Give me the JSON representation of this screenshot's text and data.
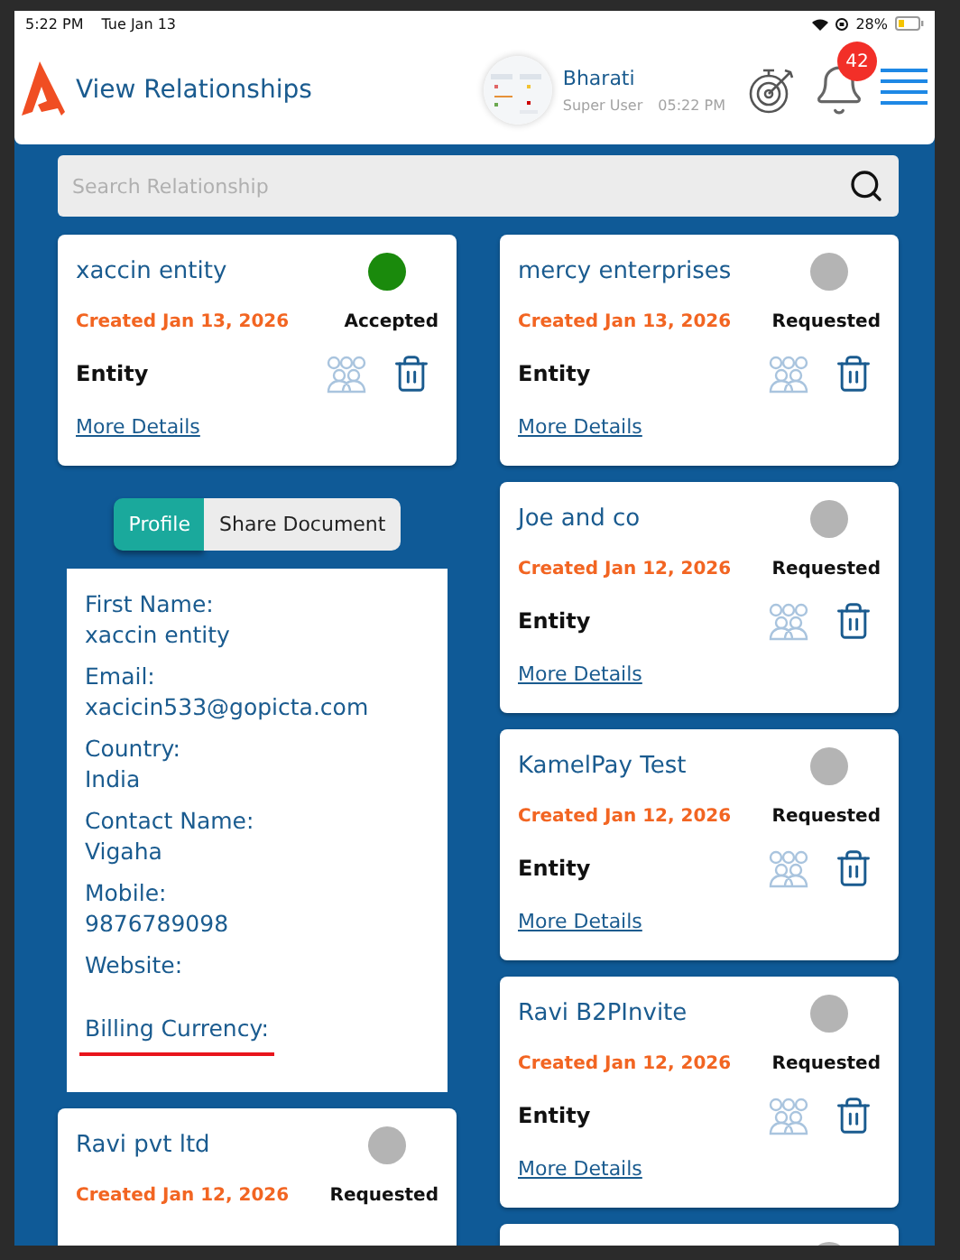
{
  "status_bar": {
    "time": "5:22 PM",
    "date": "Tue Jan 13",
    "battery": "28%"
  },
  "header": {
    "title": "View Relationships",
    "user_name": "Bharati",
    "role": "Super User",
    "time": "05:22 PM",
    "notification_count": "42"
  },
  "search": {
    "placeholder": "Search Relationship"
  },
  "left_cards": [
    {
      "name": "xaccin entity",
      "created": "Created Jan 13, 2026",
      "status": "Accepted",
      "color": "#1a8a0c",
      "type": "Entity",
      "link": "More Details"
    }
  ],
  "profile_tabs": [
    {
      "label": "Profile",
      "selected": true
    },
    {
      "label": "Share Document",
      "selected": false
    }
  ],
  "profile_fields": [
    {
      "label": "First Name:",
      "value": "xaccin entity",
      "highlighted": false
    },
    {
      "label": "Email:",
      "value": "xacicin533@gopicta.com",
      "highlighted": false
    },
    {
      "label": "Country:",
      "value": "India",
      "highlighted": false
    },
    {
      "label": "Contact Name:",
      "value": "Vigaha",
      "highlighted": false
    },
    {
      "label": "Mobile:",
      "value": "9876789098",
      "highlighted": false
    },
    {
      "label": "Website:",
      "highlighted": false
    },
    {
      "label": "Billing Currency:",
      "highlighted": true
    }
  ],
  "left_cards_after": [
    {
      "name": "Ravi pvt ltd",
      "created": "Created Jan 12, 2026",
      "status": "Requested",
      "color": "#b4b4b4"
    }
  ],
  "right_cards": [
    {
      "name": "mercy enterprises",
      "created": "Created Jan 13, 2026",
      "status": "Requested",
      "color": "#b4b4b4",
      "type": "Entity",
      "link": "More Details"
    },
    {
      "name": "Joe and co",
      "created": "Created Jan 12, 2026",
      "status": "Requested",
      "color": "#b4b4b4",
      "type": "Entity",
      "link": "More Details"
    },
    {
      "name": "KamelPay Test",
      "created": "Created Jan 12, 2026",
      "status": "Requested",
      "color": "#b4b4b4",
      "type": "Entity",
      "link": "More Details"
    },
    {
      "name": "Ravi B2PInvite",
      "created": "Created Jan 12, 2026",
      "status": "Requested",
      "color": "#b4b4b4",
      "type": "Entity",
      "link": "More Details"
    },
    {
      "color": "#b4b4b4"
    }
  ]
}
